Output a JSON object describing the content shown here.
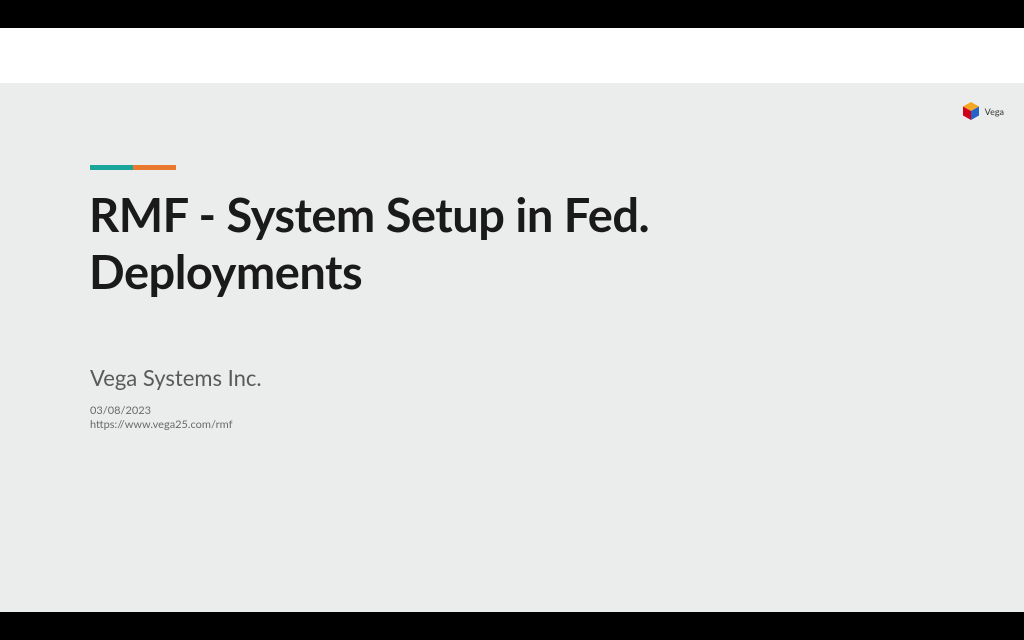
{
  "logo": {
    "text": "Vega"
  },
  "slide": {
    "title": "RMF - System Setup in Fed. Deployments",
    "company": "Vega Systems Inc.",
    "date": "03/08/2023",
    "url": "https://www.vega25.com/rmf"
  }
}
